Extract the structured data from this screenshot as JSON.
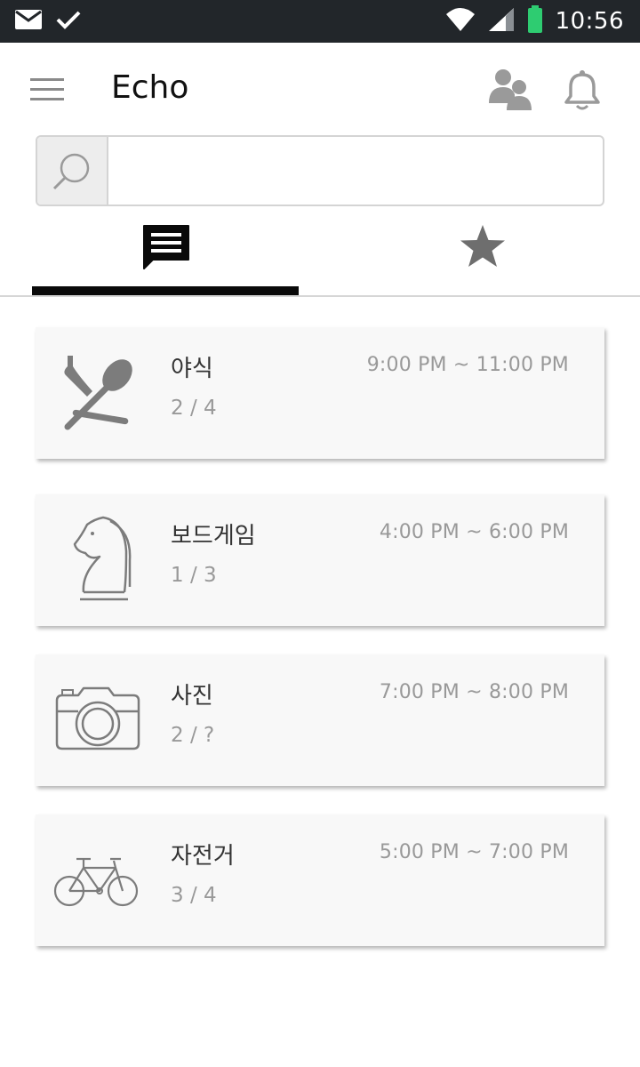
{
  "status_bar": {
    "time": "10:56",
    "icons": [
      "mail-icon",
      "check-icon",
      "wifi-icon",
      "signal-icon",
      "battery-icon"
    ],
    "battery_color": "#2ecc71"
  },
  "app_bar": {
    "title": "Echo",
    "icons": [
      "menu-icon",
      "people-icon",
      "bell-icon"
    ]
  },
  "search": {
    "placeholder": "",
    "value": ""
  },
  "tabs": [
    {
      "id": "chat",
      "icon": "chat-icon",
      "active": true
    },
    {
      "id": "favorites",
      "icon": "star-icon",
      "active": false
    }
  ],
  "cards": [
    {
      "icon": "fork-spoon-icon",
      "name": "야식",
      "count": "2 / 4",
      "time": "9:00 PM ~ 11:00 PM"
    },
    {
      "icon": "chess-knight-icon",
      "name": "보드게임",
      "count": "1 / 3",
      "time": "4:00 PM ~ 6:00 PM"
    },
    {
      "icon": "camera-icon",
      "name": "사진",
      "count": "2 / ?",
      "time": "7:00 PM ~ 8:00 PM"
    },
    {
      "icon": "bicycle-icon",
      "name": "자전거",
      "count": "3 / 4",
      "time": "5:00 PM ~ 7:00 PM"
    }
  ],
  "colors": {
    "status_bar_bg": "#22262a",
    "tab_indicator": "#0a0a0a",
    "card_bg": "#f8f8f8",
    "icon_gray": "#8a8a8a"
  }
}
